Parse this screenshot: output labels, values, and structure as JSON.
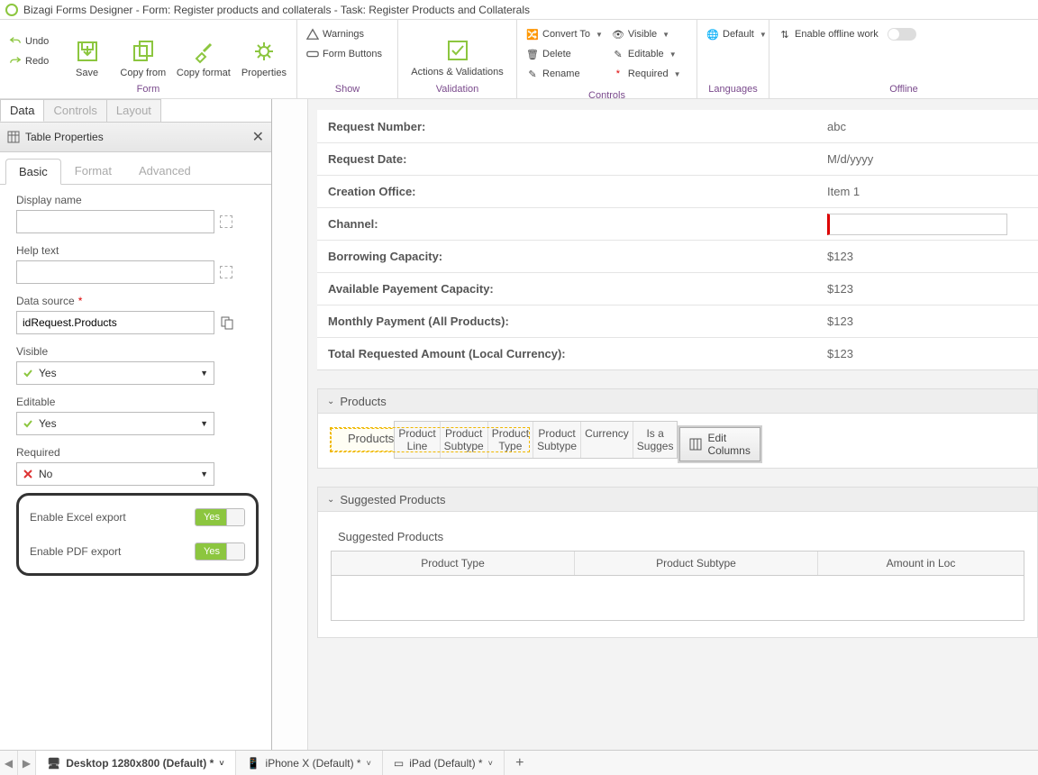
{
  "title": "Bizagi Forms Designer  -  Form: Register products and collaterals - Task:  Register Products and Collaterals",
  "ribbon": {
    "undo": "Undo",
    "redo": "Redo",
    "save": "Save",
    "copy_from": "Copy from",
    "copy_format": "Copy format",
    "properties": "Properties",
    "group_form": "Form",
    "warnings": "Warnings",
    "form_buttons": "Form Buttons",
    "group_show": "Show",
    "actions_validations": "Actions & Validations",
    "group_validation": "Validation",
    "convert_to": "Convert To",
    "delete": "Delete",
    "rename": "Rename",
    "visible": "Visible",
    "editable": "Editable",
    "required": "Required",
    "group_controls": "Controls",
    "default": "Default",
    "group_languages": "Languages",
    "enable_offline": "Enable offline work",
    "group_offline": "Offline"
  },
  "left_tabs": {
    "data": "Data",
    "controls": "Controls",
    "layout": "Layout"
  },
  "panel": {
    "title": "Table Properties",
    "tabs": {
      "basic": "Basic",
      "format": "Format",
      "advanced": "Advanced"
    },
    "display_name": "Display name",
    "help_text": "Help text",
    "data_source": "Data source",
    "data_source_value": "idRequest.Products",
    "visible": "Visible",
    "visible_value": "Yes",
    "editable": "Editable",
    "editable_value": "Yes",
    "required": "Required",
    "required_value": "No",
    "enable_excel": "Enable Excel export",
    "enable_excel_value": "Yes",
    "enable_pdf": "Enable PDF export",
    "enable_pdf_value": "Yes"
  },
  "form": {
    "rows": [
      {
        "label": "Request Number:",
        "value": "abc"
      },
      {
        "label": "Request Date:",
        "value": "M/d/yyyy"
      },
      {
        "label": "Creation Office:",
        "value": "Item 1"
      },
      {
        "label": "Channel:",
        "value": ""
      },
      {
        "label": "Borrowing Capacity:",
        "value": "$123"
      },
      {
        "label": "Available Payement Capacity:",
        "value": "$123"
      },
      {
        "label": "Monthly Payment (All Products):",
        "value": "$123"
      },
      {
        "label": "Total Requested Amount (Local Currency):",
        "value": "$123"
      }
    ]
  },
  "products": {
    "section": "Products",
    "table_title": "Products",
    "cols": [
      "Product Line",
      "Product Subtype",
      "Product Type",
      "Product Subtype",
      "Currency",
      "Is a Sugges"
    ],
    "edit_columns": "Edit Columns"
  },
  "suggested": {
    "section": "Suggested Products",
    "table_title": "Suggested Products",
    "cols": [
      "Product Type",
      "Product Subtype",
      "Amount in Loc"
    ]
  },
  "devices": {
    "desktop": "Desktop 1280x800 (Default) *",
    "iphone": "iPhone X (Default) *",
    "ipad": "iPad (Default) *"
  }
}
